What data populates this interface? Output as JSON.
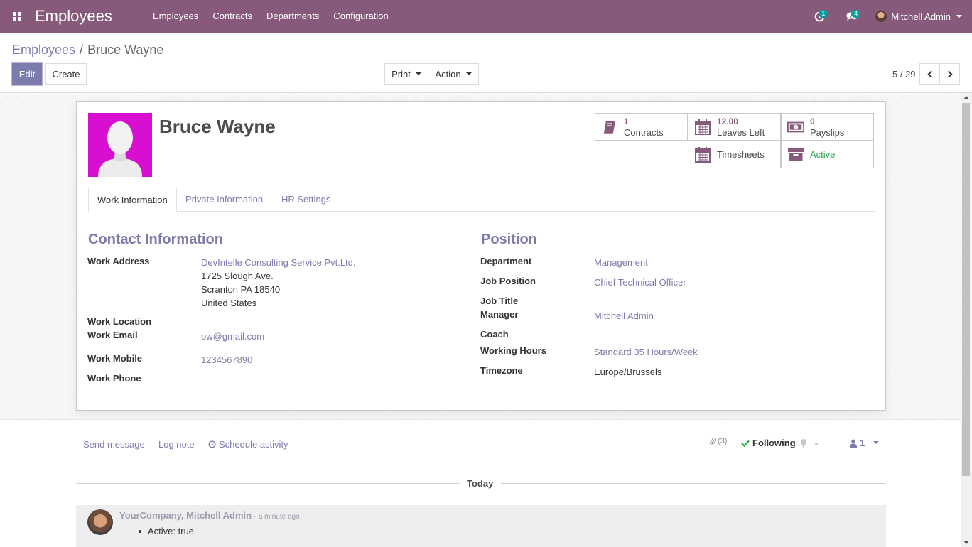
{
  "app": {
    "title": "Employees",
    "menu": [
      "Employees",
      "Contracts",
      "Departments",
      "Configuration"
    ]
  },
  "systray": {
    "activity_count": "1",
    "message_count": "4",
    "user_name": "Mitchell Admin"
  },
  "breadcrumb": {
    "parent": "Employees",
    "current": "Bruce Wayne"
  },
  "buttons": {
    "edit": "Edit",
    "create": "Create",
    "print": "Print",
    "action": "Action"
  },
  "pager": {
    "value": "5 / 29"
  },
  "employee": {
    "name": "Bruce Wayne"
  },
  "smart_buttons": {
    "contracts": {
      "value": "1",
      "label": "Contracts"
    },
    "leaves": {
      "value": "12.00",
      "label": "Leaves Left"
    },
    "payslips": {
      "value": "0",
      "label": "Payslips"
    },
    "timesheets": {
      "label": "Timesheets"
    },
    "active": {
      "label": "Active",
      "color": "#28a745"
    }
  },
  "tabs": [
    "Work Information",
    "Private Information",
    "HR Settings"
  ],
  "contact": {
    "title": "Contact Information",
    "labels": {
      "work_address": "Work Address",
      "work_location": "Work Location",
      "work_email": "Work Email",
      "work_mobile": "Work Mobile",
      "work_phone": "Work Phone"
    },
    "address": {
      "company": "DevIntelle Consulting Service Pvt.Ltd.",
      "street": "1725 Slough Ave.",
      "city": "Scranton PA 18540",
      "country": "United States"
    },
    "work_email": "bw@gmail.com",
    "work_mobile": "1234567890"
  },
  "position": {
    "title": "Position",
    "labels": {
      "department": "Department",
      "job_position": "Job Position",
      "job_title": "Job Title",
      "manager": "Manager",
      "coach": "Coach",
      "working_hours": "Working Hours",
      "timezone": "Timezone"
    },
    "department": "Management",
    "job_position": "Chief Technical Officer",
    "manager": "Mitchell Admin",
    "working_hours": "Standard 35 Hours/Week",
    "timezone": "Europe/Brussels"
  },
  "chatter": {
    "send_message": "Send message",
    "log_note": "Log note",
    "schedule_activity": "Schedule activity",
    "attachments": "(3)",
    "following": "Following",
    "followers": "1",
    "today": "Today",
    "message": {
      "author": "YourCompany, Mitchell Admin",
      "date": "- a minute ago",
      "body": "Active: true"
    }
  },
  "colors": {
    "brand": "#875a7b",
    "link": "#7c7bad",
    "photo_bg": "#d80fd1",
    "success": "#28a745"
  }
}
